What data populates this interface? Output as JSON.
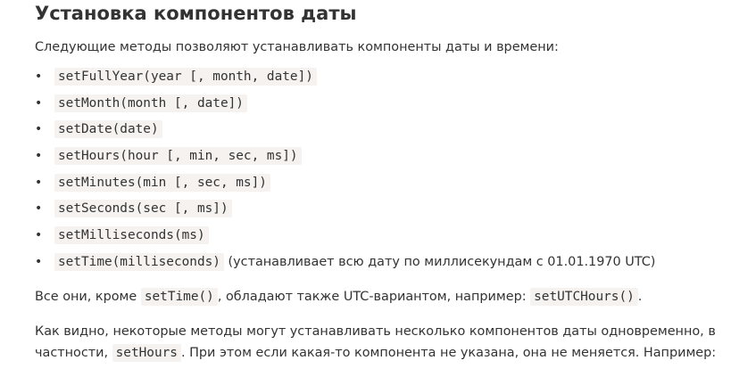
{
  "heading": "Установка компонентов даты",
  "intro": "Следующие методы позволяют устанавливать компоненты даты и времени:",
  "methods": [
    {
      "code": "setFullYear(year [, month, date])",
      "note": ""
    },
    {
      "code": "setMonth(month [, date])",
      "note": ""
    },
    {
      "code": "setDate(date)",
      "note": ""
    },
    {
      "code": "setHours(hour [, min, sec, ms])",
      "note": ""
    },
    {
      "code": "setMinutes(min [, sec, ms])",
      "note": ""
    },
    {
      "code": "setSeconds(sec [, ms])",
      "note": ""
    },
    {
      "code": "setMilliseconds(ms)",
      "note": ""
    },
    {
      "code": "setTime(milliseconds)",
      "note": "(устанавливает всю дату по миллисекундам с 01.01.1970 UTC)"
    }
  ],
  "bullet_glyph": "•",
  "paragraph1": {
    "t1": "Все они, кроме",
    "c1": "setTime()",
    "t2": ", обладают также UTC-вариантом, например:",
    "c2": "setUTCHours()",
    "t3": "."
  },
  "paragraph2": {
    "t1": "Как видно, некоторые методы могут устанавливать несколько компонентов даты одновременно, в частности,",
    "c1": "setHours",
    "t2": ". При этом если какая-то компонента не указана, она не меняется. Например:"
  }
}
